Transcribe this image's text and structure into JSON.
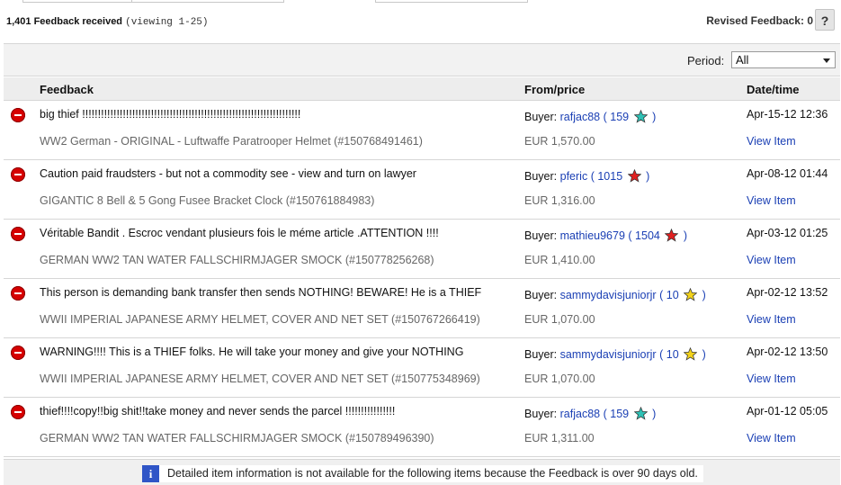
{
  "summary": {
    "count": "1,401 Feedback received",
    "viewing": "(viewing 1-25)"
  },
  "revised": {
    "label": "Revised Feedback: 0"
  },
  "help": {
    "label": "?"
  },
  "filter": {
    "period_label": "Period:",
    "period_value": "All"
  },
  "columns": {
    "feedback": "Feedback",
    "from_price": "From/price",
    "date_time": "Date/time"
  },
  "rows": [
    {
      "comment": "big thief !!!!!!!!!!!!!!!!!!!!!!!!!!!!!!!!!!!!!!!!!!!!!!!!!!!!!!!!!!!!!!!!!!!!!!",
      "item": "WW2 German - ORIGINAL - Luftwaffe Paratrooper Helmet (#150768491461)",
      "buyer_label": "Buyer:",
      "user": "rafjac88",
      "score": "159",
      "star": "turquoise-star-icon",
      "star_color": "#2fc1b5",
      "price": "EUR 1,570.00",
      "date": "Apr-15-12 12:36",
      "view": "View Item"
    },
    {
      "comment": "Caution paid fraudsters - but not a commodity see - view and turn on lawyer",
      "item": "GIGANTIC 8 Bell & 5 Gong Fusee Bracket Clock (#150761884983)",
      "buyer_label": "Buyer:",
      "user": "pferic",
      "score": "1015",
      "star": "red-star-icon",
      "star_color": "#e02020",
      "price": "EUR 1,316.00",
      "date": "Apr-08-12 01:44",
      "view": "View Item"
    },
    {
      "comment": "Véritable Bandit . Escroc vendant plusieurs fois le méme article .ATTENTION !!!!",
      "item": "GERMAN WW2 TAN WATER FALLSCHIRMJAGER SMOCK (#150778256268)",
      "buyer_label": "Buyer:",
      "user": "mathieu9679",
      "score": "1504",
      "star": "red-star-icon",
      "star_color": "#e02020",
      "price": "EUR 1,410.00",
      "date": "Apr-03-12 01:25",
      "view": "View Item"
    },
    {
      "comment": "This person is demanding bank transfer then sends NOTHING! BEWARE! He is a THIEF",
      "item": "WWII IMPERIAL JAPANESE ARMY HELMET, COVER AND NET SET (#150767266419)",
      "buyer_label": "Buyer:",
      "user": "sammydavisjuniorjr",
      "score": "10",
      "star": "yellow-star-icon",
      "star_color": "#f2d21b",
      "price": "EUR 1,070.00",
      "date": "Apr-02-12 13:52",
      "view": "View Item"
    },
    {
      "comment": "WARNING!!!! This is a THIEF folks. He will take your money and give your NOTHING",
      "item": "WWII IMPERIAL JAPANESE ARMY HELMET, COVER AND NET SET (#150775348969)",
      "buyer_label": "Buyer:",
      "user": "sammydavisjuniorjr",
      "score": "10",
      "star": "yellow-star-icon",
      "star_color": "#f2d21b",
      "price": "EUR 1,070.00",
      "date": "Apr-02-12 13:50",
      "view": "View Item"
    },
    {
      "comment": "thief!!!!copy!!big shit!!take money and never sends the parcel !!!!!!!!!!!!!!!!",
      "item": "GERMAN WW2 TAN WATER FALLSCHIRMJAGER SMOCK (#150789496390)",
      "buyer_label": "Buyer:",
      "user": "rafjac88",
      "score": "159",
      "star": "turquoise-star-icon",
      "star_color": "#2fc1b5",
      "price": "EUR 1,311.00",
      "date": "Apr-01-12 05:05",
      "view": "View Item"
    }
  ],
  "info": {
    "icon": "i",
    "text": "Detailed item information is not available for the following items because the Feedback is over 90 days old."
  }
}
